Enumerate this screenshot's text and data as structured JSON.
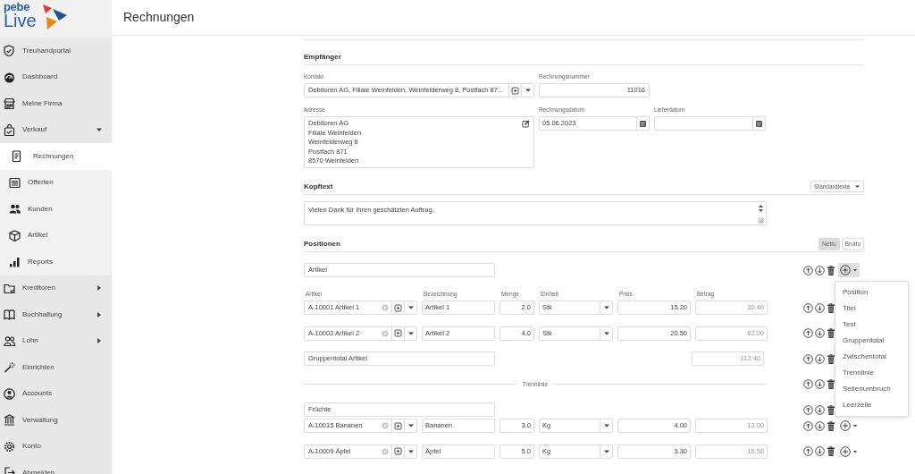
{
  "logo": {
    "line_1": "pebe",
    "line_2": "Live"
  },
  "sidebar": {
    "items": [
      {
        "label": "Treuhandportal",
        "selected": false
      },
      {
        "label": "Dashboard",
        "selected": false
      },
      {
        "label": "Meine Firma",
        "selected": false
      },
      {
        "label": "Verkauf",
        "selected": false,
        "expandable": true,
        "expanded": true,
        "children": [
          {
            "label": "Rechnungen",
            "selected": true
          },
          {
            "label": "Offerten",
            "selected": false
          },
          {
            "label": "Kunden",
            "selected": false
          },
          {
            "label": "Artikel",
            "selected": false
          },
          {
            "label": "Reports",
            "selected": false
          }
        ]
      },
      {
        "label": "Kreditoren",
        "selected": false,
        "expandable": true,
        "expanded": false
      },
      {
        "label": "Buchhaltung",
        "selected": false,
        "expandable": true,
        "expanded": false
      },
      {
        "label": "Lohn",
        "selected": false,
        "expandable": true,
        "expanded": false
      },
      {
        "label": "Einrichten",
        "selected": false
      },
      {
        "label": "Accounts",
        "selected": false
      },
      {
        "label": "Verwaltung",
        "selected": false
      },
      {
        "label": "Konto",
        "selected": false
      },
      {
        "label": "Abmelden",
        "selected": false
      }
    ]
  },
  "page_title": "Rechnungen",
  "recipient": {
    "heading": "Empfänger",
    "contact": {
      "label": "Kontakt",
      "value": "Debitoren AG, Filiale Weinfelden, Weinfelderweg 8, Postfach 87..."
    },
    "invoice_number": {
      "label": "Rechnungsnummer",
      "value": "11016"
    },
    "address": {
      "label": "Adresse",
      "lines": [
        "Debitoren AG",
        "Filiale Weinfelden",
        "Weinfelderweg 8",
        "Postfach 871",
        "8570 Weinfelden"
      ]
    },
    "invoice_date": {
      "label": "Rechnungsdatum",
      "value": "05.06.2023"
    },
    "delivery_date": {
      "label": "Lieferdatum"
    }
  },
  "header_text": {
    "heading": "Kopftext",
    "templates_button": "Standardtexte",
    "value": "Vielen Dank für Ihren geschätzten Auftrag."
  },
  "positions": {
    "heading": "Positionen",
    "price_modes": [
      {
        "label": "Netto",
        "selected": true
      },
      {
        "label": "Brutto",
        "selected": false
      }
    ],
    "columns": [
      "Artikel",
      "Bezeichnung",
      "Menge",
      "Einheit",
      "Preis",
      "Betrag"
    ],
    "rows": [
      {
        "kind": "title",
        "text": "Artikel",
        "menu_open": true
      },
      {
        "kind": "article",
        "article": "A-10001 Artikel 1",
        "description": "Artikel 1",
        "quantity": "2.0",
        "unit": "Stk",
        "price": "15.20",
        "amount": "30.40"
      },
      {
        "kind": "article",
        "article": "A-10002 Artikel 2",
        "description": "Artikel 2",
        "quantity": "4.0",
        "unit": "Stk",
        "price": "20.50",
        "amount": "82.00"
      },
      {
        "kind": "group_total",
        "text": "Gruppentotal Artikel",
        "amount": "112.40"
      },
      {
        "kind": "divider",
        "label": "Trennlinie"
      },
      {
        "kind": "title",
        "text": "Früchte"
      },
      {
        "kind": "article",
        "article": "A-10015 Bananen",
        "description": "Bananen",
        "quantity": "3.0",
        "unit": "Kg",
        "price": "4.00",
        "amount": "12.00",
        "menu_open": false
      },
      {
        "kind": "article",
        "article": "A-10009 Äpfel",
        "description": "Äpfel",
        "quantity": "5.0",
        "unit": "Kg",
        "price": "3.30",
        "amount": "16.50",
        "menu_open": false
      }
    ],
    "add_menu_items": [
      "Position",
      "Titel",
      "Text",
      "Gruppentotal",
      "Zwischentotal",
      "Trennlinie",
      "Seitenumbruch",
      "Leerzeile"
    ]
  }
}
